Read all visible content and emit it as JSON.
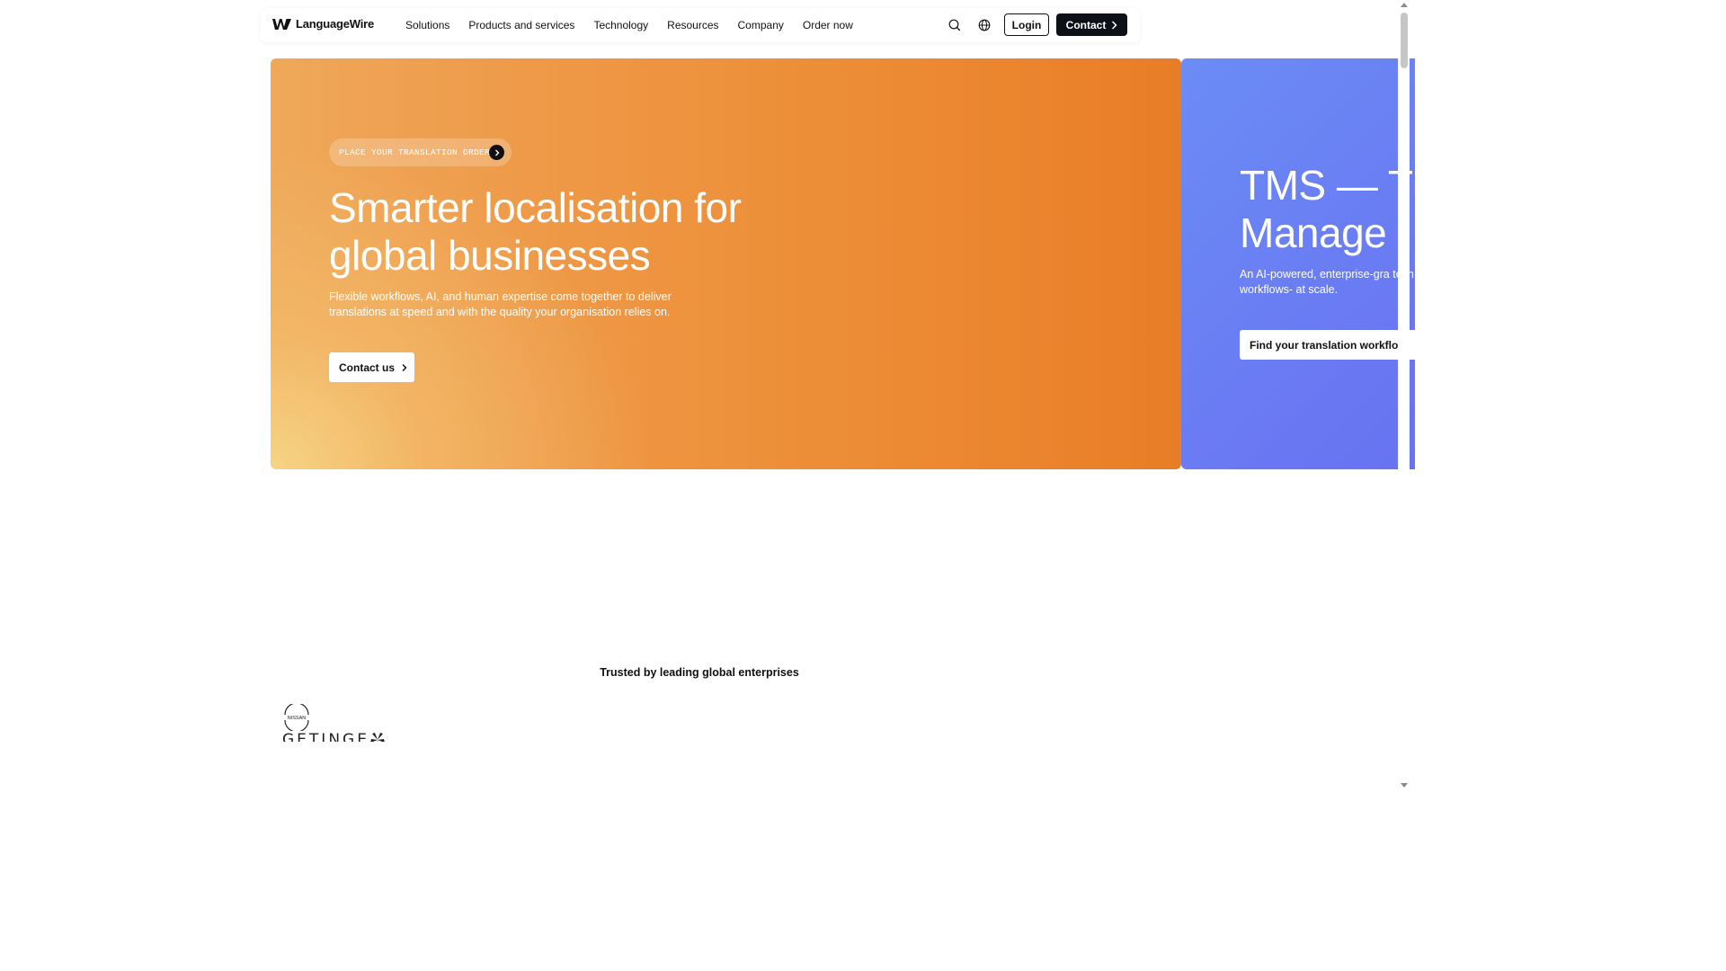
{
  "nav": {
    "brand": "LanguageWire",
    "links": [
      "Solutions",
      "Products and services",
      "Technology",
      "Resources",
      "Company",
      "Order now"
    ],
    "login_label": "Login",
    "contact_label": "Contact"
  },
  "hero": {
    "pill_label": "PLACE YOUR TRANSLATION ORDER",
    "title": "Smarter localisation for global businesses",
    "description": "Flexible workflows, AI, and human expertise come together to deliver translations at speed and with the quality your organisation relies on.",
    "cta_label": "Contact us",
    "background_colors": [
      "#f6d484",
      "#ee9744",
      "#e97d27"
    ]
  },
  "next_slide": {
    "title_line1": "TMS — T",
    "title_line2": "Manage",
    "description": "An AI-powered, enterprise-gra tech, and translation goals. Sim workflows- at scale.",
    "cta_label": "Find your translation workflow",
    "background_color": "#6b83f4"
  },
  "trusted": {
    "heading": "Trusted by leading global enterprises",
    "logos": [
      "NISSAN",
      "GETINGE"
    ]
  }
}
